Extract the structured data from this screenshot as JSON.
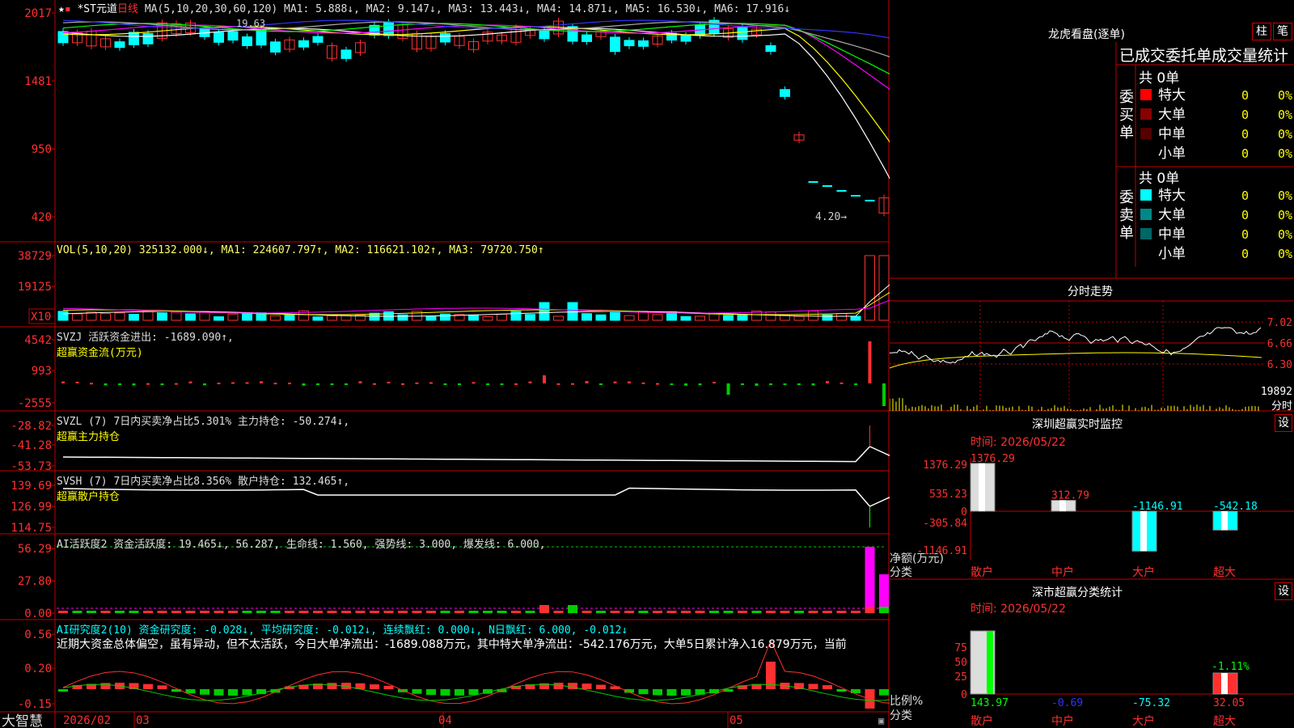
{
  "stock": {
    "name": "*ST元道",
    "period": "日线"
  },
  "panels": {
    "price": {
      "header": "MA(5,10,20,30,60,120) MA1: 5.888↓, MA2: 9.147↓, MA3: 13.443↓, MA4: 14.871↓, MA5: 16.530↓, MA6: 17.916↓",
      "yticks": [
        "2017",
        "1481",
        "950",
        "420"
      ],
      "high_label": "19.63",
      "low_label": "4.20→"
    },
    "vol": {
      "header": "VOL(5,10,20) 325132.000↓, MA1: 224607.797↑, MA2: 116621.102↑, MA3: 79720.750↑",
      "yticks": [
        "38729",
        "19125"
      ],
      "unit": "X10"
    },
    "svzj": {
      "header": "SVZJ  活跃资金进出: -1689.090↑,",
      "subheader": "超赢资金流(万元)",
      "yticks": [
        "4542",
        "993",
        "-2555"
      ]
    },
    "svzl": {
      "header": "SVZL (7) 7日内买卖净占比5.301% 主力持仓: -50.274↓,",
      "subheader": "超赢主力持仓",
      "yticks": [
        "-28.82",
        "-41.28",
        "-53.73"
      ]
    },
    "svsh": {
      "header": "SVSH (7) 7日内买卖净占比8.356% 散户持仓: 132.465↑,",
      "subheader": "超赢散户持仓",
      "yticks": [
        "139.69",
        "126.99",
        "114.75"
      ]
    },
    "ai1": {
      "header": "AI活跃度2 资金活跃度: 19.465↓, 56.287, 生命线: 1.560, 强势线: 3.000, 爆发线: 6.000,",
      "yticks": [
        "56.29",
        "27.80",
        "0.00"
      ]
    },
    "ai2": {
      "header": "AI研究度2(10) 资金研究度: -0.028↓, 平均研究度: -0.012↓, 连续飘红: 0.000↓, N日飘红: 6.000, -0.012↓",
      "text": "近期大资金总体偏空，虽有异动，但不太活跃，今日大单净流出：-1689.088万元，其中特大单净流出：-542.176万元，大单5日累计净入16.879万元，当前",
      "yticks": [
        "0.56",
        "0.20",
        "-0.15"
      ]
    }
  },
  "xaxis": {
    "brand": "大智慧",
    "labels": [
      "2026/02",
      "03",
      "04",
      "05"
    ]
  },
  "dragon": {
    "title": "龙虎看盘(逐单)",
    "btn1": "柱",
    "btn2": "笔",
    "tabs": "已成交委托单成交量统计",
    "buy_title": "委买单",
    "sell_title": "委卖单",
    "buy_total": "共 0单",
    "sell_total": "共 0单",
    "rows_buy": [
      {
        "label": "特大",
        "value": "0",
        "pct": "0%",
        "color": "#ff0000"
      },
      {
        "label": "大单",
        "value": "0",
        "pct": "0%",
        "color": "#880000"
      },
      {
        "label": "中单",
        "value": "0",
        "pct": "0%",
        "color": "#550000"
      },
      {
        "label": "小单",
        "value": "0",
        "pct": "0%",
        "color": ""
      }
    ],
    "rows_sell": [
      {
        "label": "特大",
        "value": "0",
        "pct": "0%",
        "color": "#00ffff"
      },
      {
        "label": "大单",
        "value": "0",
        "pct": "0%",
        "color": "#008888"
      },
      {
        "label": "中单",
        "value": "0",
        "pct": "0%",
        "color": "#006666"
      },
      {
        "label": "小单",
        "value": "0",
        "pct": "0%",
        "color": ""
      }
    ]
  },
  "intraday": {
    "title": "分时走势",
    "prices": [
      "7.02",
      "6.66",
      "6.30"
    ],
    "vol": "19892",
    "vol_label": "分时"
  },
  "monitor": {
    "title": "深圳超赢实时监控",
    "date": "时间: 2026/05/22",
    "btn": "设",
    "yticks": [
      "1376.29",
      "535.23",
      "0",
      "-305.84",
      "-1146.91"
    ],
    "ylabel": "净额(万元)",
    "xlabel": "分类",
    "cats": [
      "散户",
      "中户",
      "大户",
      "超大"
    ],
    "values": [
      "1376.29",
      "312.79",
      "-1146.91",
      "-542.18"
    ]
  },
  "classstat": {
    "title": "深市超赢分类统计",
    "date": "时间: 2026/05/22",
    "btn": "设",
    "yticks": [
      "75",
      "50",
      "25",
      "0"
    ],
    "ylabel": "比例%",
    "xlabel": "分类",
    "cats": [
      "散户",
      "中户",
      "大户",
      "超大"
    ],
    "values": [
      "143.97",
      "-0.69",
      "-75.32",
      "32.05"
    ],
    "top_label": "-1.11%"
  },
  "chart_data": [
    {
      "type": "candlestick",
      "title": "*ST元道 日线",
      "ylim": [
        420,
        2017
      ],
      "series": [
        {
          "name": "MA1",
          "values": [
            5.888
          ]
        },
        {
          "name": "MA2",
          "values": [
            9.147
          ]
        },
        {
          "name": "MA3",
          "values": [
            13.443
          ]
        },
        {
          "name": "MA4",
          "values": [
            14.871
          ]
        },
        {
          "name": "MA5",
          "values": [
            16.53
          ]
        },
        {
          "name": "MA6",
          "values": [
            17.916
          ]
        }
      ]
    },
    {
      "type": "bar",
      "title": "VOL",
      "values": [
        325132.0
      ]
    },
    {
      "type": "bar",
      "title": "深圳超赢实时监控",
      "categories": [
        "散户",
        "中户",
        "大户",
        "超大"
      ],
      "values": [
        1376.29,
        312.79,
        -1146.91,
        -542.18
      ],
      "ylim": [
        -1146.91,
        1376.29
      ]
    },
    {
      "type": "bar",
      "title": "深市超赢分类统计",
      "categories": [
        "散户",
        "中户",
        "大户",
        "超大"
      ],
      "values": [
        143.97,
        -0.69,
        -75.32,
        32.05
      ]
    }
  ],
  "colors": {
    "up": "#ff3030",
    "down": "#00ffff",
    "frame": "#c00000",
    "ma1": "#ffffff",
    "ma2": "#ffff00",
    "ma3": "#ff00ff",
    "ma4": "#00ff00",
    "ma5": "#aaaaaa",
    "ma6": "#3333ff"
  }
}
